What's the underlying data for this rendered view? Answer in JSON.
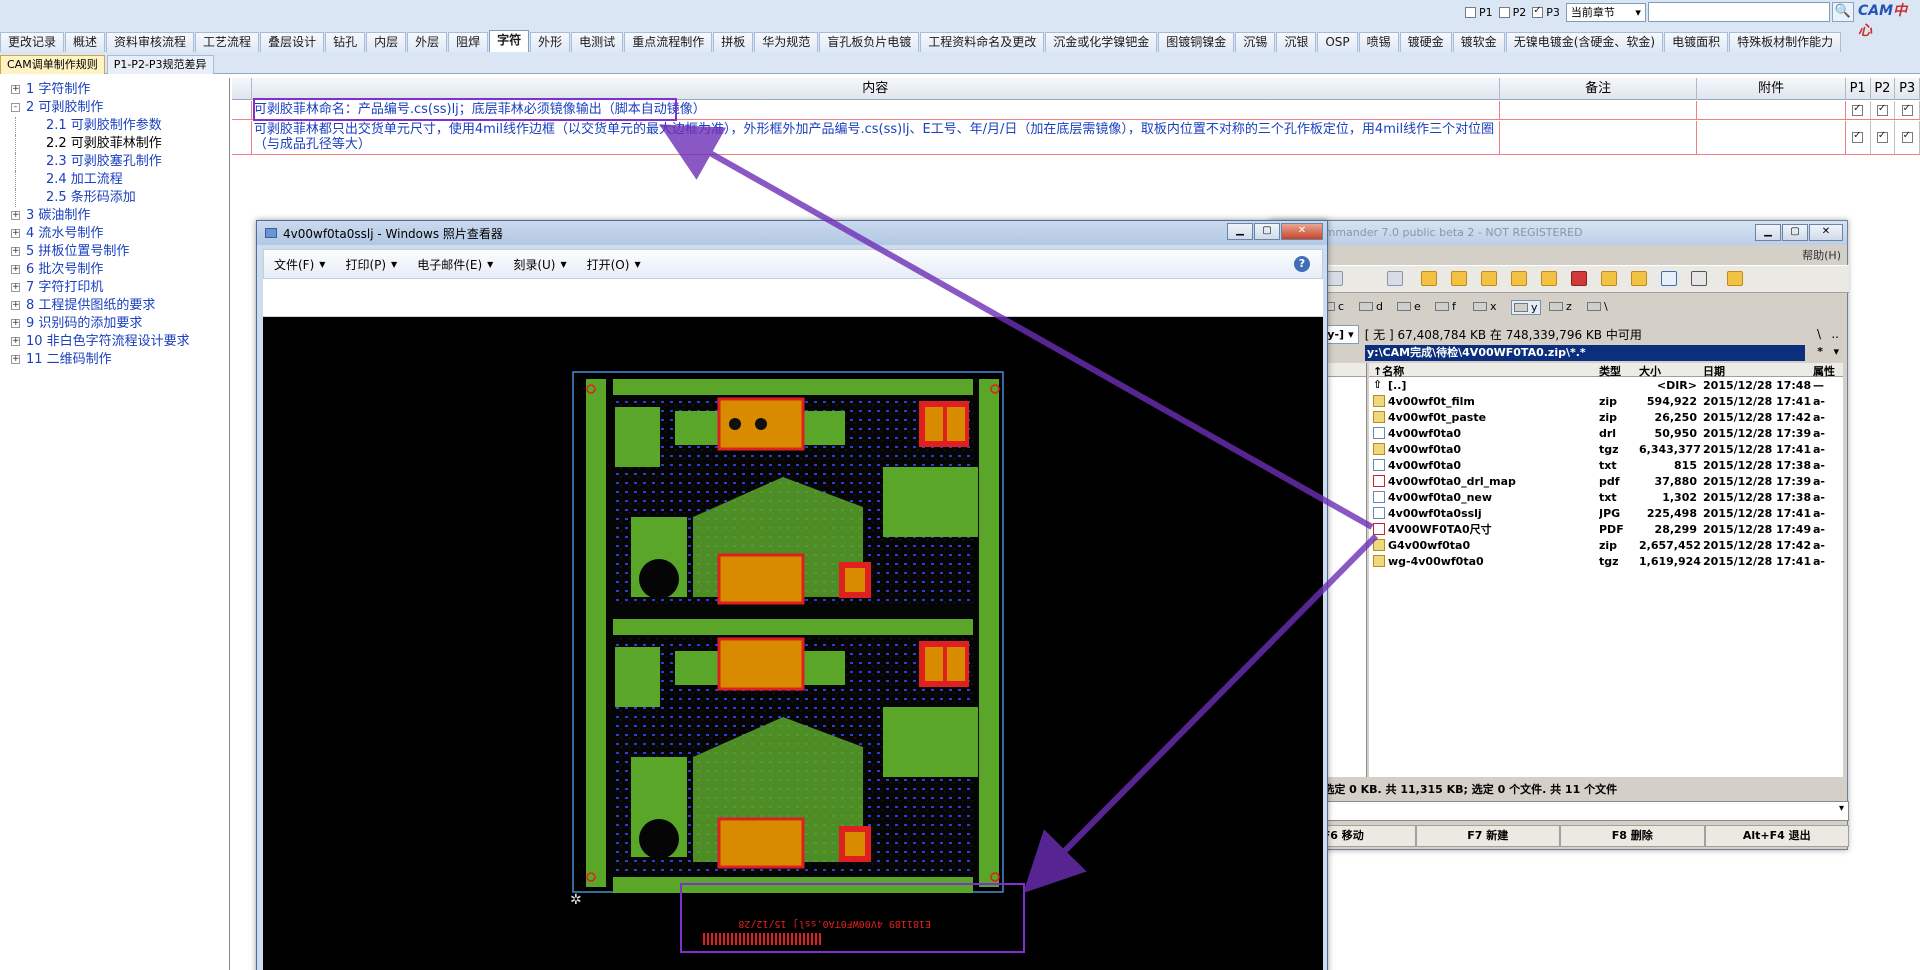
{
  "top_tabs": [
    "更改记录",
    "概述",
    "资料审核流程",
    "工艺流程",
    "叠层设计",
    "钻孔",
    "内层",
    "外层",
    "阻焊",
    "字符",
    "外形",
    "电测试",
    "重点流程制作",
    "拼板",
    "华为规范",
    "盲孔板负片电镀",
    "工程资料命名及更改",
    "沉金或化学镍钯金",
    "图镀铜镍金",
    "沉锡",
    "沉银",
    "OSP",
    "喷锡",
    "镀硬金",
    "镀软金",
    "无镍电镀金(含硬金、软金)",
    "电镀面积",
    "特殊板材制作能力"
  ],
  "active_tab": "字符",
  "sub_tabs": [
    "CAM调单制作规则",
    "P1-P2-P3规范差异"
  ],
  "filters": {
    "p1": "P1",
    "p2": "P2",
    "p3": "P3",
    "p3_checked": true,
    "scope": "当前章节"
  },
  "logo": {
    "a": "CAM",
    "b": "中心"
  },
  "tree": [
    {
      "label": "1  字符制作",
      "level": 1,
      "exp": "+"
    },
    {
      "label": "2  可剥胶制作",
      "level": 1,
      "exp": "-"
    },
    {
      "label": "2.1  可剥胶制作参数",
      "level": 2
    },
    {
      "label": "2.2  可剥胶菲林制作",
      "level": 2,
      "selected": true
    },
    {
      "label": "2.3  可剥胶塞孔制作",
      "level": 2
    },
    {
      "label": "2.4  加工流程",
      "level": 2
    },
    {
      "label": "2.5  条形码添加",
      "level": 2
    },
    {
      "label": "3  碳油制作",
      "level": 1,
      "exp": "+"
    },
    {
      "label": "4  流水号制作",
      "level": 1,
      "exp": "+"
    },
    {
      "label": "5  拼板位置号制作",
      "level": 1,
      "exp": "+"
    },
    {
      "label": "6  批次号制作",
      "level": 1,
      "exp": "+"
    },
    {
      "label": "7  字符打印机",
      "level": 1,
      "exp": "+"
    },
    {
      "label": "8  工程提供图纸的要求",
      "level": 1,
      "exp": "+"
    },
    {
      "label": "9  识别码的添加要求",
      "level": 1,
      "exp": "+"
    },
    {
      "label": "10  非白色字符流程设计要求",
      "level": 1,
      "exp": "+"
    },
    {
      "label": "11  二维码制作",
      "level": 1,
      "exp": "+"
    }
  ],
  "table": {
    "headers": {
      "content": "内容",
      "remark": "备注",
      "attach": "附件",
      "p1": "P1",
      "p2": "P2",
      "p3": "P3"
    },
    "rows": [
      {
        "content": "可剥胶菲林命名：产品编号.cs(ss)lj；底层菲林必须镜像输出（脚本自动镜像）"
      },
      {
        "content": "可剥胶菲林都只出交货单元尺寸，使用4mil线作边框（以交货单元的最大边框为准），外形框外加产品编号.cs(ss)lj、E工号、年/月/日（加在底层需镜像），取板内位置不对称的三个孔作板定位，用4mil线作三个对位圈（与成品孔径等大）"
      }
    ]
  },
  "viewer": {
    "title": "4v00wf0ta0sslj - Windows 照片查看器",
    "menu": [
      "文件(F)",
      "打印(P)",
      "电子邮件(E)",
      "刻录(U)",
      "打开(O)"
    ],
    "help": "?",
    "barcode_text": "E181189  4V00WF0TA0.sslj  15/12/28"
  },
  "tc": {
    "title": "Total Commander 7.0 public beta 2 - NOT REGISTERED",
    "help": "帮助(H)",
    "drives": [
      "c",
      "d",
      "e",
      "f",
      "x",
      "y",
      "z",
      "\\"
    ],
    "active_drive": "y",
    "drive_select": "[-y-]",
    "free_info": "[ 无 ]  67,408,784 KB 在 748,339,796 KB 中可用",
    "path": "y:\\CAM完成\\待检\\4V00WF0TA0.zip\\*.*",
    "cols": {
      "name": "↑名称",
      "type": "类型",
      "size": "大小",
      "date": "日期",
      "attr": "属性"
    },
    "files": [
      {
        "name": "[..]",
        "type": "",
        "size": "<DIR>",
        "date": "2015/12/28 17:48",
        "attr": "—",
        "icon": "up"
      },
      {
        "name": "4v00wf0t_film",
        "type": "zip",
        "size": "594,922",
        "date": "2015/12/28 17:41",
        "attr": "a-",
        "icon": "z"
      },
      {
        "name": "4v00wf0t_paste",
        "type": "zip",
        "size": "26,250",
        "date": "2015/12/28 17:42",
        "attr": "a-",
        "icon": "z"
      },
      {
        "name": "4v00wf0ta0",
        "type": "drl",
        "size": "50,950",
        "date": "2015/12/28 17:39",
        "attr": "a-",
        "icon": "f"
      },
      {
        "name": "4v00wf0ta0",
        "type": "tgz",
        "size": "6,343,377",
        "date": "2015/12/28 17:41",
        "attr": "a-",
        "icon": "z"
      },
      {
        "name": "4v00wf0ta0",
        "type": "txt",
        "size": "815",
        "date": "2015/12/28 17:38",
        "attr": "a-",
        "icon": "f"
      },
      {
        "name": "4v00wf0ta0_drl_map",
        "type": "pdf",
        "size": "37,880",
        "date": "2015/12/28 17:39",
        "attr": "a-",
        "icon": "pdf"
      },
      {
        "name": "4v00wf0ta0_new",
        "type": "txt",
        "size": "1,302",
        "date": "2015/12/28 17:38",
        "attr": "a-",
        "icon": "f"
      },
      {
        "name": "4v00wf0ta0sslj",
        "type": "JPG",
        "size": "225,498",
        "date": "2015/12/28 17:41",
        "attr": "a-",
        "icon": "f"
      },
      {
        "name": "4V00WF0TA0尺寸",
        "type": "PDF",
        "size": "28,299",
        "date": "2015/12/28 17:49",
        "attr": "a-",
        "icon": "pdf"
      },
      {
        "name": "G4v00wf0ta0",
        "type": "zip",
        "size": "2,657,452",
        "date": "2015/12/28 17:42",
        "attr": "a-",
        "icon": "z"
      },
      {
        "name": "wg-4v00wf0ta0",
        "type": "tgz",
        "size": "1,619,924",
        "date": "2015/12/28 17:41",
        "attr": "a-",
        "icon": "z"
      }
    ],
    "status": "0 个文件 选定 0 KB. 共 11,315 KB; 选定 0 个文件. 共 11 个文件",
    "fkeys": [
      "F6 移动",
      "F7 新建",
      "F8 删除",
      "Alt+F4 退出"
    ]
  },
  "colors": {
    "highlight": "#8030d0",
    "arrow": "#6d2fb6",
    "pcb_green": "#5aa629",
    "pcb_orange": "#d98b00",
    "pcb_red": "#e02020",
    "tree_text": "#1a3fbf"
  }
}
